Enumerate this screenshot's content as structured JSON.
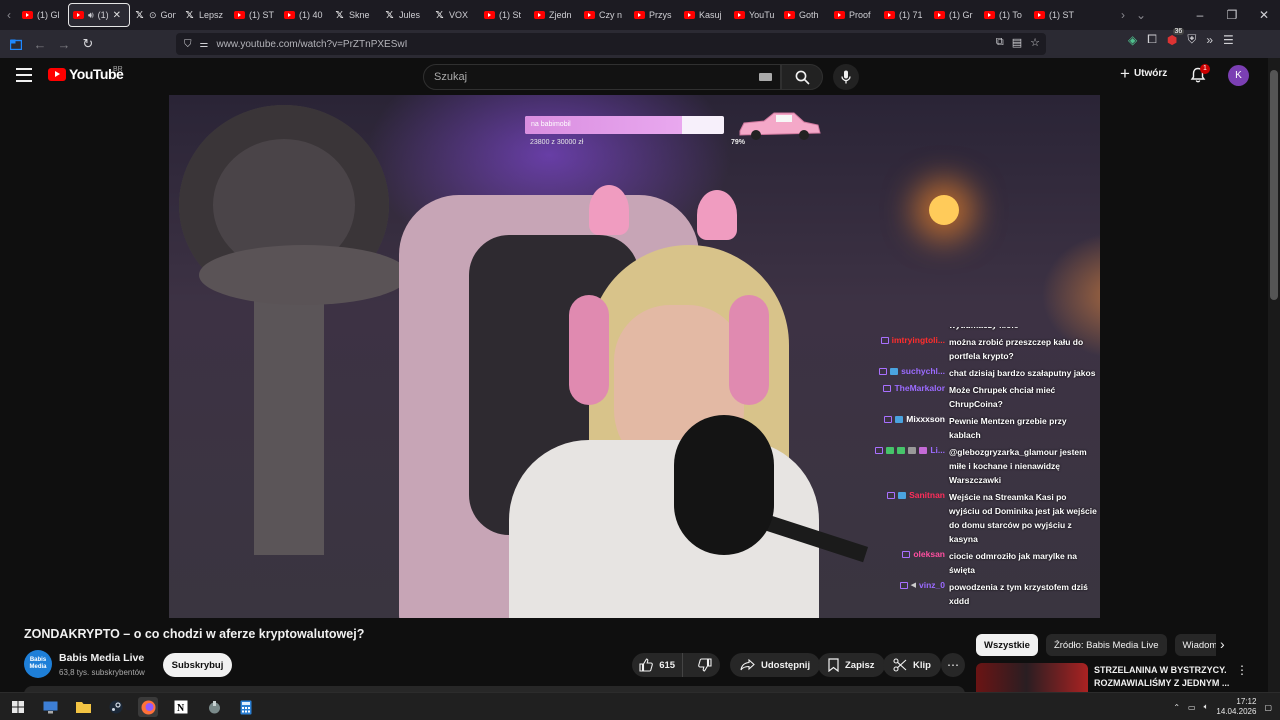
{
  "browser": {
    "tabs": [
      {
        "favicon": "youtube-icon",
        "title": "(1) Gl"
      },
      {
        "favicon": "youtube-icon",
        "title": "(1)",
        "audio": true,
        "active": true
      },
      {
        "favicon": "x-icon",
        "title": "Gonie",
        "extra": "podcast-icon"
      },
      {
        "favicon": "x-icon",
        "title": "Lepsz"
      },
      {
        "favicon": "youtube-icon",
        "title": "(1) ST"
      },
      {
        "favicon": "youtube-icon",
        "title": "(1) 40"
      },
      {
        "favicon": "x-icon",
        "title": "Skne"
      },
      {
        "favicon": "x-icon",
        "title": "Jules"
      },
      {
        "favicon": "x-icon",
        "title": "VOX"
      },
      {
        "favicon": "youtube-icon",
        "title": "(1) St"
      },
      {
        "favicon": "youtube-icon",
        "title": "Zjedn"
      },
      {
        "favicon": "youtube-icon",
        "title": "Czy n"
      },
      {
        "favicon": "youtube-icon",
        "title": "Przys"
      },
      {
        "favicon": "youtube-icon",
        "title": "Kasuj"
      },
      {
        "favicon": "youtube-icon",
        "title": "YouTu"
      },
      {
        "favicon": "youtube-icon",
        "title": "Goth"
      },
      {
        "favicon": "youtube-icon",
        "title": "Proof"
      },
      {
        "favicon": "youtube-icon",
        "title": "(1) 71"
      },
      {
        "favicon": "youtube-icon",
        "title": "(1) Gr"
      },
      {
        "favicon": "youtube-icon",
        "title": "(1) To"
      },
      {
        "favicon": "youtube-icon",
        "title": "(1) ST"
      }
    ],
    "url": "www.youtube.com/watch?v=PrZTnPXESwI",
    "extension_badge": "36"
  },
  "masthead": {
    "logo_text": "YouTube",
    "country_code": "BR",
    "search_placeholder": "Szukaj",
    "create_label": "Utwórz",
    "notification_count": "1",
    "avatar_letter": "K"
  },
  "video": {
    "overlay": {
      "goal_label": "na babimobil",
      "goal_amount": "23800  z  30000  zł",
      "goal_percent_text": "79%",
      "goal_fraction": 0.79
    },
    "chat": [
      {
        "user": "",
        "color": "#ffffff",
        "message": "wytłumaczy kłółe",
        "badges": []
      },
      {
        "user": "imtryingtoli...",
        "color": "#ff2d2d",
        "message": "można zrobić przeszczep kału do portfela krypto?",
        "badges": [
          "twitch"
        ]
      },
      {
        "user": "suchychl...",
        "color": "#9b6bff",
        "message": "chat dzisiaj bardzo szałaputny jakos",
        "badges": [
          "twitch",
          "emote-blue"
        ]
      },
      {
        "user": "TheMarkalor",
        "color": "#9b6bff",
        "message": "Może Chrupek chciał mieć ChrupCoina?",
        "badges": [
          "twitch"
        ]
      },
      {
        "user": "Mixxxson",
        "color": "#ffffff",
        "message": "Pewnie Mentzen grzebie przy kablach",
        "badges": [
          "twitch",
          "emote-blue"
        ]
      },
      {
        "user": "Li...",
        "color": "#9b6bff",
        "message": "@glebozgryzarka_glamour jestem miłe i kochane i nienawidzę Warszczawki",
        "badges": [
          "twitch",
          "emote-green",
          "emote-green",
          "emote-gray",
          "emote-purple"
        ]
      },
      {
        "user": "Sanitnan",
        "color": "#ff2d5a",
        "message": "Wejście na Streamka Kasi po wyjściu od Dominika jest jak wejście do domu starców po wyjściu z kasyna",
        "badges": [
          "twitch",
          "emote-blue"
        ]
      },
      {
        "user": "oleksan",
        "color": "#ff4fa0",
        "message": "ciocie odmroziło jak marylke na święta",
        "badges": [
          "twitch"
        ]
      },
      {
        "user": "vinz_0",
        "color": "#9b6bff",
        "message": "powodzenia z tym krzystofem dziś xddd",
        "badges": [
          "twitch",
          "speaker"
        ]
      }
    ]
  },
  "info": {
    "title": "ZONDAKRYPTO – o co chodzi w aferze kryptowalutowej?",
    "channel_name": "Babis Media Live",
    "channel_avatar_text": "Babis Media",
    "subscribers": "63,8 tys. subskrybentów",
    "subscribe_label": "Subskrybuj",
    "likes": "615",
    "share_label": "Udostępnij",
    "save_label": "Zapisz",
    "clip_label": "Klip"
  },
  "sidebar": {
    "chips": [
      "Wszystkie",
      "Źródło: Babis Media Live",
      "Wiadomości"
    ],
    "recommendation": {
      "title_line1": "STRZELANINA W BYSTRZYCY.",
      "title_line2": "ROZMAWIALIŚMY Z JEDNYM ..."
    }
  },
  "taskbar": {
    "time": "17:12",
    "date": "14.04.2026"
  },
  "colors": {
    "youtube_red": "#ff0000",
    "background": "#0f0f0f",
    "pill": "#272727",
    "twitch_purple": "#a970ff"
  }
}
